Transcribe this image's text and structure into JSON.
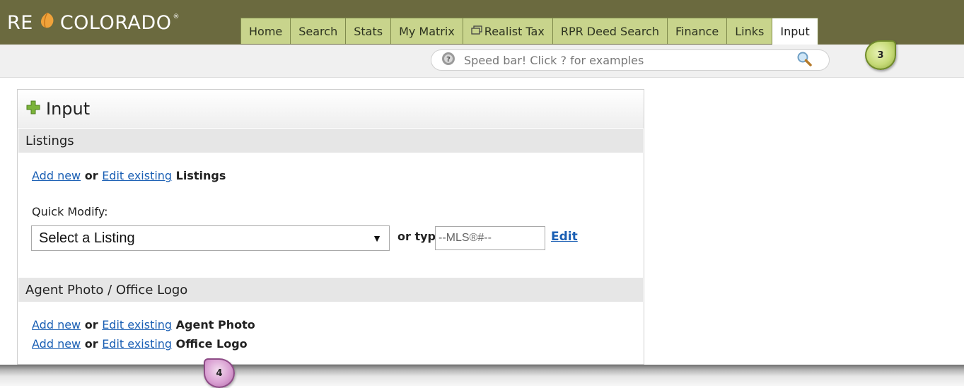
{
  "brand": {
    "logo_re": "RE",
    "logo_colorado": "COLORADO",
    "logo_mark": "®",
    "colors": {
      "header": "#6b6a3f",
      "tab": "#c8d48c",
      "link": "#1a5fb4"
    }
  },
  "tabs": [
    {
      "label": "Home"
    },
    {
      "label": "Search"
    },
    {
      "label": "Stats"
    },
    {
      "label": "My Matrix"
    },
    {
      "label": "Realist Tax",
      "icon": "window-icon"
    },
    {
      "label": "RPR Deed Search"
    },
    {
      "label": "Finance"
    },
    {
      "label": "Links"
    },
    {
      "label": "Input",
      "active": true
    }
  ],
  "speedbar": {
    "placeholder": "Speed bar! Click ? for examples"
  },
  "callouts": {
    "step3": "3",
    "step4": "4"
  },
  "panel": {
    "title": "Input",
    "listings": {
      "heading": "Listings",
      "add_new": "Add new",
      "or": "or",
      "edit_existing": "Edit existing",
      "suffix": "Listings",
      "quick_modify_label": "Quick Modify:",
      "select_value": "Select a Listing",
      "or_type": "or type",
      "mls_placeholder": "--MLS®#--",
      "edit_link": "Edit"
    },
    "photo_logo": {
      "heading": "Agent Photo / Office Logo",
      "rows": [
        {
          "add_new": "Add new",
          "or": "or",
          "edit_existing": "Edit existing",
          "suffix": "Agent Photo"
        },
        {
          "add_new": "Add new",
          "or": "or",
          "edit_existing": "Edit existing",
          "suffix": "Office Logo"
        }
      ]
    }
  }
}
